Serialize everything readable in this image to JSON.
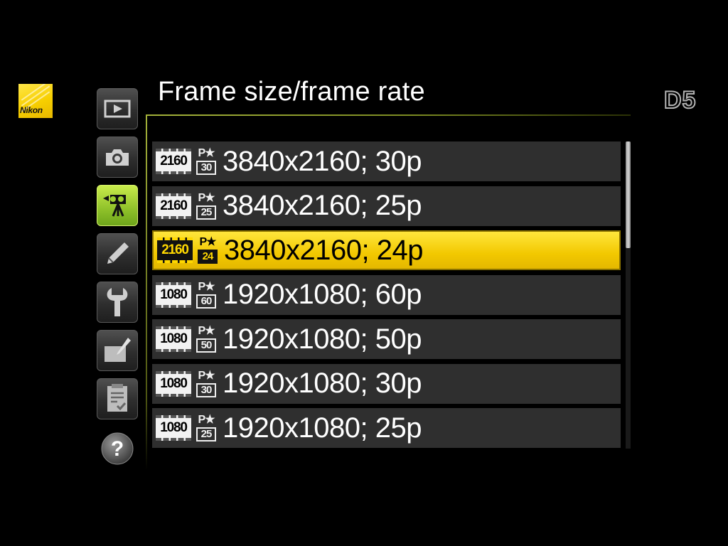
{
  "brand": {
    "logo_text": "Nikon",
    "model": "D5"
  },
  "menu": {
    "title": "Frame size/frame rate"
  },
  "tabs": [
    {
      "name": "playback",
      "icon": "playback-icon"
    },
    {
      "name": "photo-shooting",
      "icon": "camera-icon"
    },
    {
      "name": "movie-shooting",
      "icon": "movie-camera-icon",
      "active": true
    },
    {
      "name": "custom-settings",
      "icon": "pencil-icon"
    },
    {
      "name": "setup",
      "icon": "wrench-icon"
    },
    {
      "name": "retouch",
      "icon": "retouch-icon"
    },
    {
      "name": "my-menu",
      "icon": "my-menu-icon"
    },
    {
      "name": "help",
      "icon": "help-icon"
    }
  ],
  "options": [
    {
      "res": "2160",
      "rate_top": "P★",
      "rate": "30",
      "label": "3840x2160; 30p",
      "selected": false
    },
    {
      "res": "2160",
      "rate_top": "P★",
      "rate": "25",
      "label": "3840x2160; 25p",
      "selected": false
    },
    {
      "res": "2160",
      "rate_top": "P★",
      "rate": "24",
      "label": "3840x2160; 24p",
      "selected": true
    },
    {
      "res": "1080",
      "rate_top": "P★",
      "rate": "60",
      "label": "1920x1080; 60p",
      "selected": false
    },
    {
      "res": "1080",
      "rate_top": "P★",
      "rate": "50",
      "label": "1920x1080; 50p",
      "selected": false
    },
    {
      "res": "1080",
      "rate_top": "P★",
      "rate": "30",
      "label": "1920x1080; 30p",
      "selected": false
    },
    {
      "res": "1080",
      "rate_top": "P★",
      "rate": "25",
      "label": "1920x1080; 25p",
      "selected": false
    }
  ],
  "colors": {
    "accent": "#8fc12a",
    "selection": "#f2c800",
    "row_bg": "#2f2f2f",
    "background": "#000000"
  }
}
